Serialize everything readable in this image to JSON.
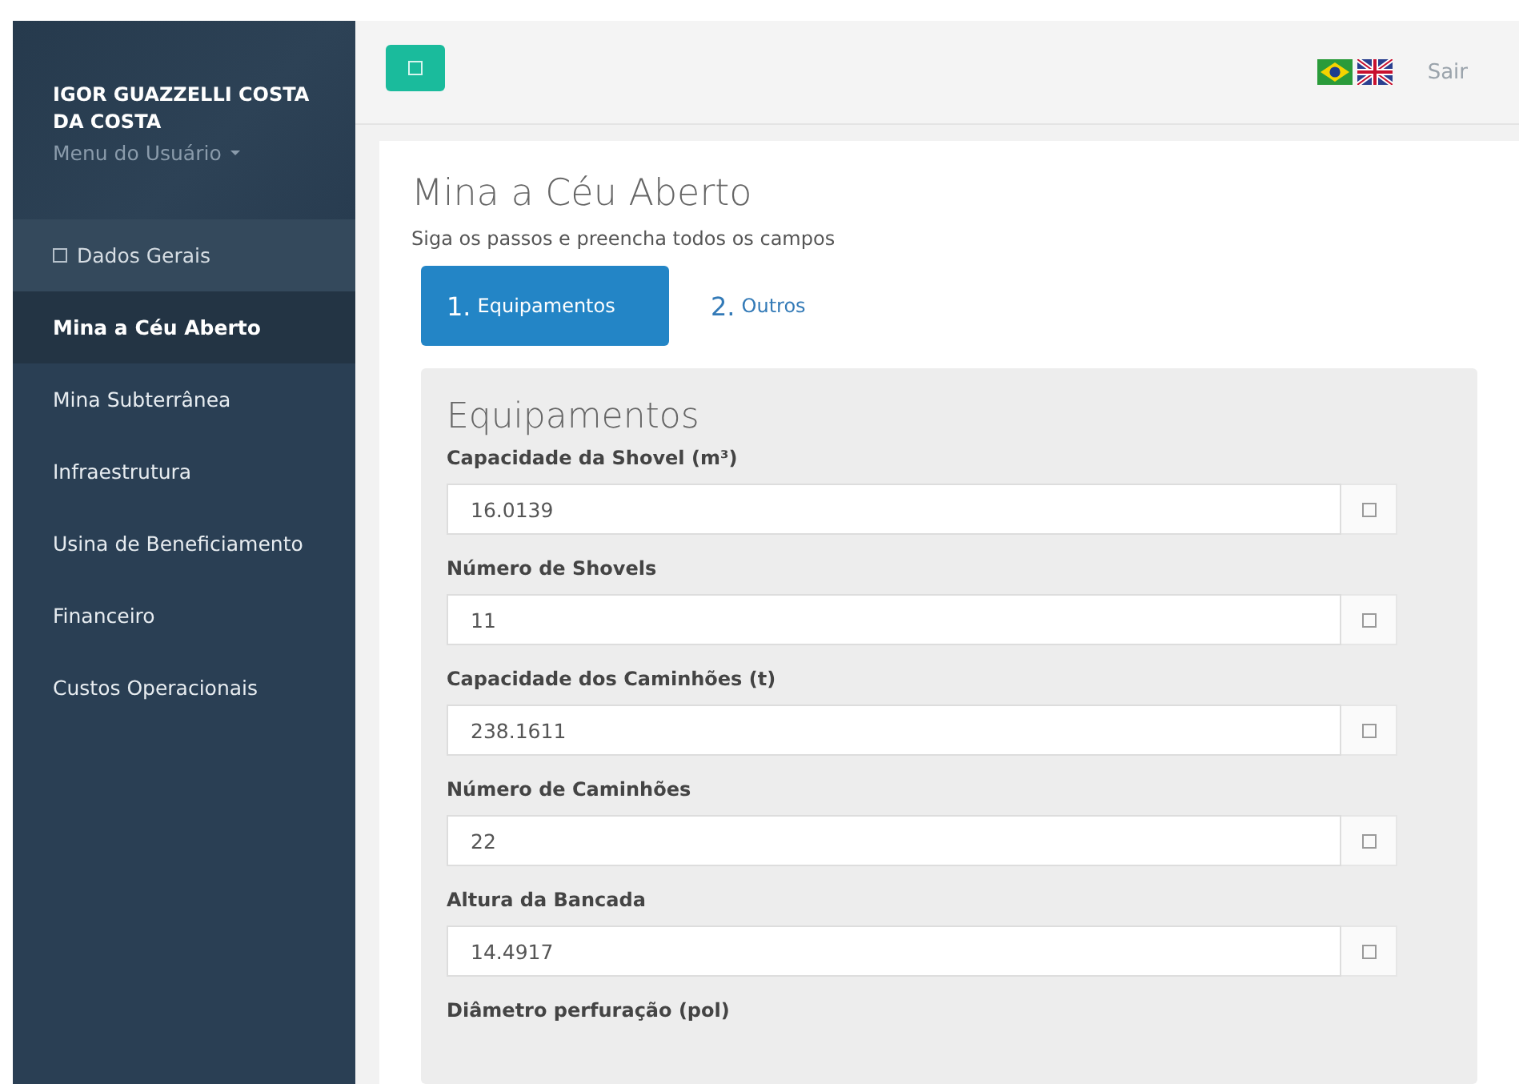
{
  "sidebar": {
    "user_name": "IGOR GUAZZELLI COSTA DA COSTA",
    "user_menu": "Menu do Usuário",
    "items": [
      {
        "label": "Dados Gerais",
        "kind": "icon",
        "selected": false
      },
      {
        "label": "Mina a Céu Aberto",
        "kind": "plain",
        "selected": true
      },
      {
        "label": "Mina Subterrânea",
        "kind": "plain",
        "selected": false
      },
      {
        "label": "Infraestrutura",
        "kind": "plain",
        "selected": false
      },
      {
        "label": "Usina de Beneficiamento",
        "kind": "plain",
        "selected": false
      },
      {
        "label": "Financeiro",
        "kind": "plain",
        "selected": false
      },
      {
        "label": "Custos Operacionais",
        "kind": "plain",
        "selected": false
      }
    ]
  },
  "top_bar": {
    "logout": "Sair"
  },
  "page": {
    "title": "Mina a Céu Aberto",
    "subtitle": "Siga os passos e preencha todos os campos",
    "steps": [
      {
        "number": "1.",
        "label": "Equipamentos",
        "selected": true
      },
      {
        "number": "2.",
        "label": "Outros",
        "selected": false
      }
    ],
    "form": {
      "heading": "Equipamentos",
      "fields": [
        {
          "label": "Capacidade da Shovel (m³)",
          "value": "16.0139"
        },
        {
          "label": "Número de Shovels",
          "value": "11"
        },
        {
          "label": "Capacidade dos Caminhões (t)",
          "value": "238.1611"
        },
        {
          "label": "Número de Caminhões",
          "value": "22"
        },
        {
          "label": "Altura da Bancada",
          "value": "14.4917"
        },
        {
          "label": "Diâmetro perfuração (pol)"
        }
      ]
    }
  }
}
